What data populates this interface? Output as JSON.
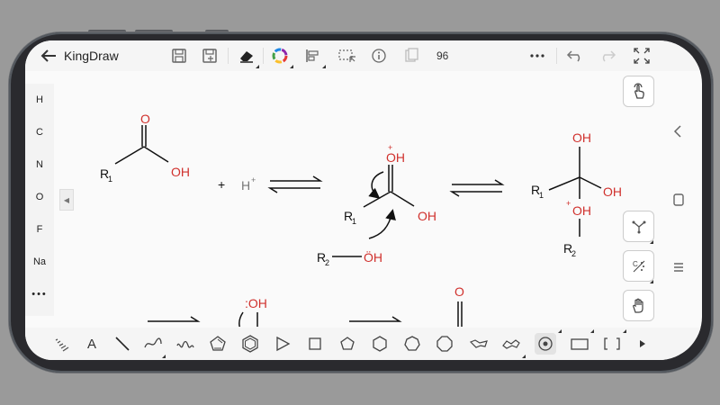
{
  "app": {
    "title": "KingDraw",
    "zoom": "96"
  },
  "elements": [
    "H",
    "C",
    "N",
    "O",
    "F",
    "Na",
    "•••"
  ],
  "bottom_tools": {
    "text_tool": "A"
  },
  "chemistry": {
    "r1": "R",
    "r1_sub": "1",
    "r2": "R",
    "r2_sub": "2",
    "o": "O",
    "oh": "OH",
    "plus": "+",
    "h": "H",
    "h_sup": "+",
    "oh_sup": "+",
    "oh2": "OH",
    "oh2_sub": "2",
    "lone_oh": ":OH",
    "r2_oh": "ÖH"
  },
  "colors": {
    "accent_red": "#d0312d",
    "bond": "#111111",
    "ui_bg": "#f5f5f5"
  }
}
